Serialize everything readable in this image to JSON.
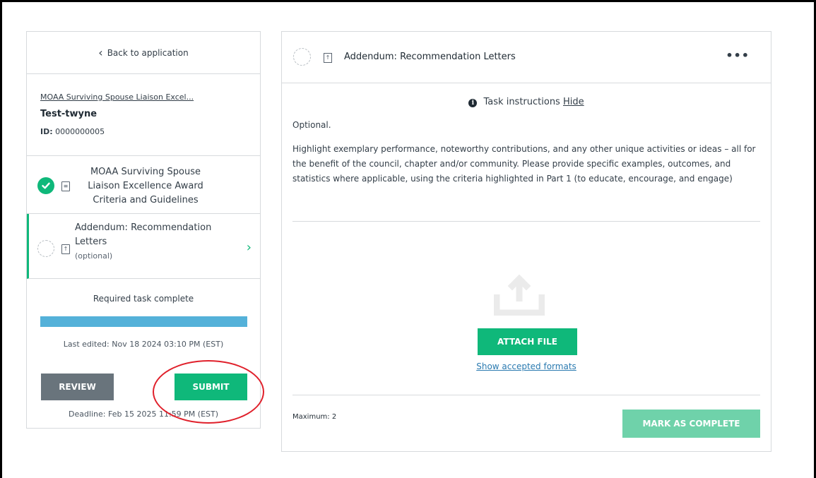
{
  "left_panel": {
    "back_link": "Back to application",
    "application": {
      "program_link": "MOAA Surviving Spouse Liaison Excel...",
      "applicant_name": "Test-twyne",
      "id_label": "ID:",
      "id_value": "0000000005"
    },
    "tasks": [
      {
        "label": "MOAA Surviving Spouse Liaison Excellence Award Criteria and Guidelines",
        "status": "complete",
        "icon": "document-icon"
      },
      {
        "label": "Addendum: Recommendation Letters",
        "optional_text": "(optional)",
        "status": "incomplete",
        "icon": "upload-file-icon",
        "selected": true
      }
    ],
    "progress": {
      "status_text": "Required task complete",
      "percent": 100,
      "last_edited": "Last edited: Nov 18 2024 03:10 PM (EST)"
    },
    "review_label": "REVIEW",
    "submit_label": "SUBMIT",
    "deadline": "Deadline: Feb 15 2025 11:59 PM (EST)"
  },
  "right_panel": {
    "title": "Addendum: Recommendation Letters",
    "more_label": "•••",
    "instructions_label": "Task instructions",
    "hide_label": "Hide",
    "optional_text": "Optional.",
    "description": "Highlight exemplary performance, noteworthy contributions, and any other unique activities or ideas – all for the benefit of the council, chapter and/or community. Please provide specific examples, outcomes, and statistics where applicable, using the criteria highlighted in Part 1 (to educate, encourage, and engage)",
    "attach_label": "ATTACH FILE",
    "formats_link": "Show accepted formats",
    "maximum": "Maximum: 2",
    "complete_label": "MARK AS COMPLETE"
  },
  "colors": {
    "accent_green": "#0fb87a",
    "progress_blue": "#54b1d9",
    "review_gray": "#69747c",
    "annotation_red": "#e0202b"
  }
}
